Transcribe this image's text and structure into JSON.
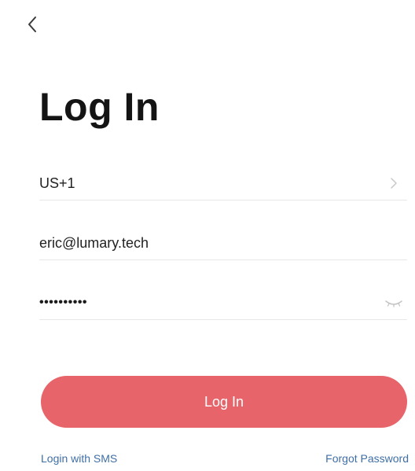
{
  "header": {
    "back_icon": "chevron-left-icon"
  },
  "title": "Log In",
  "form": {
    "country_code": "US+1",
    "country_chevron_icon": "chevron-right-icon",
    "email": "eric@lumary.tech",
    "password_masked": "••••••••••",
    "password_toggle_icon": "eye-closed-icon"
  },
  "actions": {
    "login_label": "Log In",
    "sms_link": "Login with SMS",
    "forgot_link": "Forgot Password"
  },
  "colors": {
    "primary_button": "#e7656a",
    "link": "#3f6fa7",
    "divider": "#e7e7e7"
  }
}
